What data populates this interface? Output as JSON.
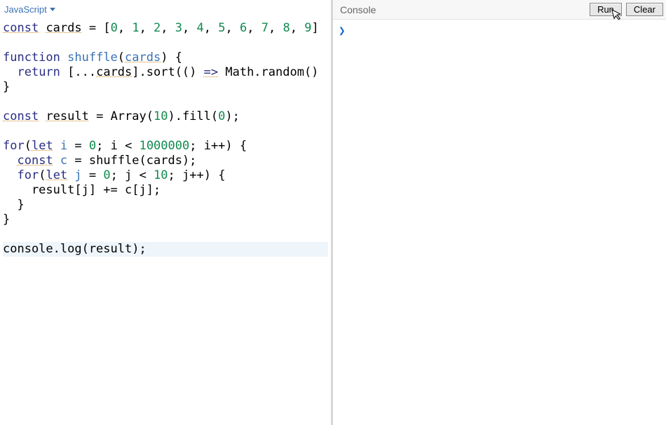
{
  "editor_header": {
    "language": "JavaScript"
  },
  "code": {
    "lines": [
      {
        "type": "line",
        "segments": [
          {
            "cls": "tok-kw squig-orange",
            "text": "const"
          },
          {
            "cls": "",
            "text": " "
          },
          {
            "cls": "squig-orange",
            "text": "cards"
          },
          {
            "cls": "",
            "text": " = ["
          },
          {
            "cls": "tok-num",
            "text": "0"
          },
          {
            "cls": "",
            "text": ", "
          },
          {
            "cls": "tok-num",
            "text": "1"
          },
          {
            "cls": "",
            "text": ", "
          },
          {
            "cls": "tok-num",
            "text": "2"
          },
          {
            "cls": "",
            "text": ", "
          },
          {
            "cls": "tok-num",
            "text": "3"
          },
          {
            "cls": "",
            "text": ", "
          },
          {
            "cls": "tok-num",
            "text": "4"
          },
          {
            "cls": "",
            "text": ", "
          },
          {
            "cls": "tok-num",
            "text": "5"
          },
          {
            "cls": "",
            "text": ", "
          },
          {
            "cls": "tok-num",
            "text": "6"
          },
          {
            "cls": "",
            "text": ", "
          },
          {
            "cls": "tok-num",
            "text": "7"
          },
          {
            "cls": "",
            "text": ", "
          },
          {
            "cls": "tok-num",
            "text": "8"
          },
          {
            "cls": "",
            "text": ", "
          },
          {
            "cls": "tok-num",
            "text": "9"
          },
          {
            "cls": "",
            "text": "]"
          }
        ]
      },
      {
        "type": "blank"
      },
      {
        "type": "line",
        "segments": [
          {
            "cls": "tok-kw",
            "text": "function"
          },
          {
            "cls": "",
            "text": " "
          },
          {
            "cls": "tok-def",
            "text": "shuffle"
          },
          {
            "cls": "",
            "text": "("
          },
          {
            "cls": "tok-def squig-orange",
            "text": "cards"
          },
          {
            "cls": "",
            "text": ") {"
          }
        ]
      },
      {
        "type": "line",
        "segments": [
          {
            "cls": "",
            "text": "  "
          },
          {
            "cls": "tok-kw",
            "text": "return"
          },
          {
            "cls": "",
            "text": " [..."
          },
          {
            "cls": "squig-orange",
            "text": "cards"
          },
          {
            "cls": "",
            "text": "].sort(() "
          },
          {
            "cls": "tok-kw squig-orange",
            "text": "=>"
          },
          {
            "cls": "",
            "text": " Math.random()"
          }
        ]
      },
      {
        "type": "line",
        "segments": [
          {
            "cls": "",
            "text": "}"
          }
        ]
      },
      {
        "type": "blank"
      },
      {
        "type": "line",
        "segments": [
          {
            "cls": "tok-kw squig-orange",
            "text": "const"
          },
          {
            "cls": "",
            "text": " "
          },
          {
            "cls": "squig-orange",
            "text": "result"
          },
          {
            "cls": "",
            "text": " = Array("
          },
          {
            "cls": "tok-num",
            "text": "10"
          },
          {
            "cls": "",
            "text": ").fill("
          },
          {
            "cls": "tok-num",
            "text": "0"
          },
          {
            "cls": "",
            "text": ");"
          }
        ]
      },
      {
        "type": "blank"
      },
      {
        "type": "line",
        "segments": [
          {
            "cls": "tok-kw",
            "text": "for"
          },
          {
            "cls": "",
            "text": "("
          },
          {
            "cls": "tok-kw squig-orange",
            "text": "let"
          },
          {
            "cls": "",
            "text": " "
          },
          {
            "cls": "tok-def",
            "text": "i"
          },
          {
            "cls": "",
            "text": " = "
          },
          {
            "cls": "tok-num",
            "text": "0"
          },
          {
            "cls": "",
            "text": "; i < "
          },
          {
            "cls": "tok-num",
            "text": "1000000"
          },
          {
            "cls": "",
            "text": "; i++) {"
          }
        ]
      },
      {
        "type": "line",
        "segments": [
          {
            "cls": "",
            "text": "  "
          },
          {
            "cls": "tok-kw squig-orange",
            "text": "const"
          },
          {
            "cls": "",
            "text": " "
          },
          {
            "cls": "tok-def",
            "text": "c"
          },
          {
            "cls": "",
            "text": " = shuffle(cards);"
          }
        ]
      },
      {
        "type": "line",
        "segments": [
          {
            "cls": "",
            "text": "  "
          },
          {
            "cls": "tok-kw",
            "text": "for"
          },
          {
            "cls": "",
            "text": "("
          },
          {
            "cls": "tok-kw squig-orange",
            "text": "let"
          },
          {
            "cls": "",
            "text": " "
          },
          {
            "cls": "tok-def",
            "text": "j"
          },
          {
            "cls": "",
            "text": " = "
          },
          {
            "cls": "tok-num",
            "text": "0"
          },
          {
            "cls": "",
            "text": "; j < "
          },
          {
            "cls": "tok-num",
            "text": "10"
          },
          {
            "cls": "",
            "text": "; j++) {"
          }
        ]
      },
      {
        "type": "line",
        "segments": [
          {
            "cls": "",
            "text": "    result[j] += c[j];"
          }
        ]
      },
      {
        "type": "line",
        "segments": [
          {
            "cls": "",
            "text": "  }"
          }
        ]
      },
      {
        "type": "line",
        "segments": [
          {
            "cls": "",
            "text": "}"
          }
        ]
      },
      {
        "type": "blank"
      },
      {
        "type": "highlight",
        "segments": [
          {
            "cls": "",
            "text": "console.log(result);"
          }
        ]
      }
    ]
  },
  "console": {
    "label": "Console",
    "run_button": "Run",
    "clear_button": "Clear",
    "prompt": "❯"
  }
}
